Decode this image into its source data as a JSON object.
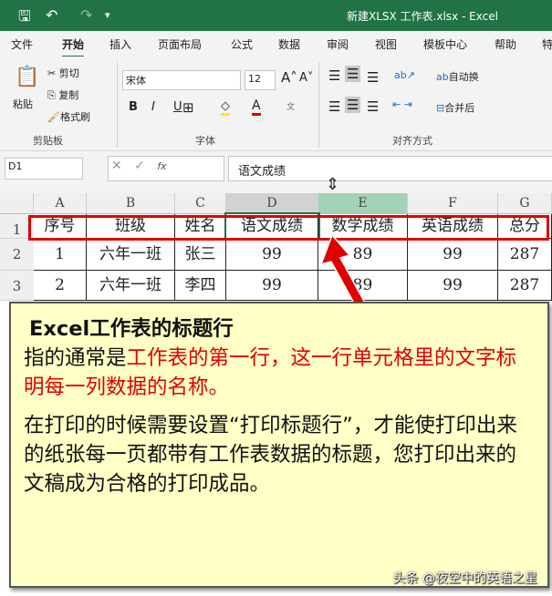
{
  "titlebar": {
    "title": "新建XLSX 工作表.xlsx  -  Excel"
  },
  "tabs": [
    "文件",
    "开始",
    "插入",
    "页面布局",
    "公式",
    "数据",
    "审阅",
    "视图",
    "模板中心",
    "帮助",
    "特"
  ],
  "ribbon": {
    "paste": "粘贴",
    "cut": "剪切",
    "copy": "复制",
    "format_painter": "格式刷",
    "clipboard": "剪贴板",
    "font_name": "宋体",
    "font_size": "12",
    "bold": "B",
    "italic": "I",
    "underline": "U",
    "font_group": "字体",
    "wrap": "自动换",
    "merge": "合并后",
    "align_group": "对齐方式"
  },
  "formula_bar": {
    "name_box": "D1",
    "fx": "fx",
    "content": "语文成绩"
  },
  "columns": [
    "A",
    "B",
    "C",
    "D",
    "E",
    "F",
    "G"
  ],
  "rows": [
    {
      "num": "1",
      "cells": [
        "序号",
        "班级",
        "姓名",
        "语文成绩",
        "数学成绩",
        "英语成绩",
        "总分"
      ]
    },
    {
      "num": "2",
      "cells": [
        "1",
        "六年一班",
        "张三",
        "99",
        "89",
        "99",
        "287"
      ]
    },
    {
      "num": "3",
      "cells": [
        "2",
        "六年一班",
        "李四",
        "99",
        "89",
        "99",
        "287"
      ]
    }
  ],
  "callout": {
    "heading": "Excel工作表的标题行",
    "line2_black": "指的通常是",
    "line2_red": "工作表的第一行，这一行单元格里的文字标明每一列数据的名称。",
    "para2": "在打印的时候需要设置“打印标题行”，才能使打印出来的纸张每一页都带有工作表数据的标题，您打印出来的文稿成为合格的打印成品。"
  },
  "watermark": "头条 @夜空中的英语之星",
  "colors": {
    "excel_green": "#217346",
    "highlight_red": "#e00000",
    "callout_bg": "#ffffc6"
  }
}
